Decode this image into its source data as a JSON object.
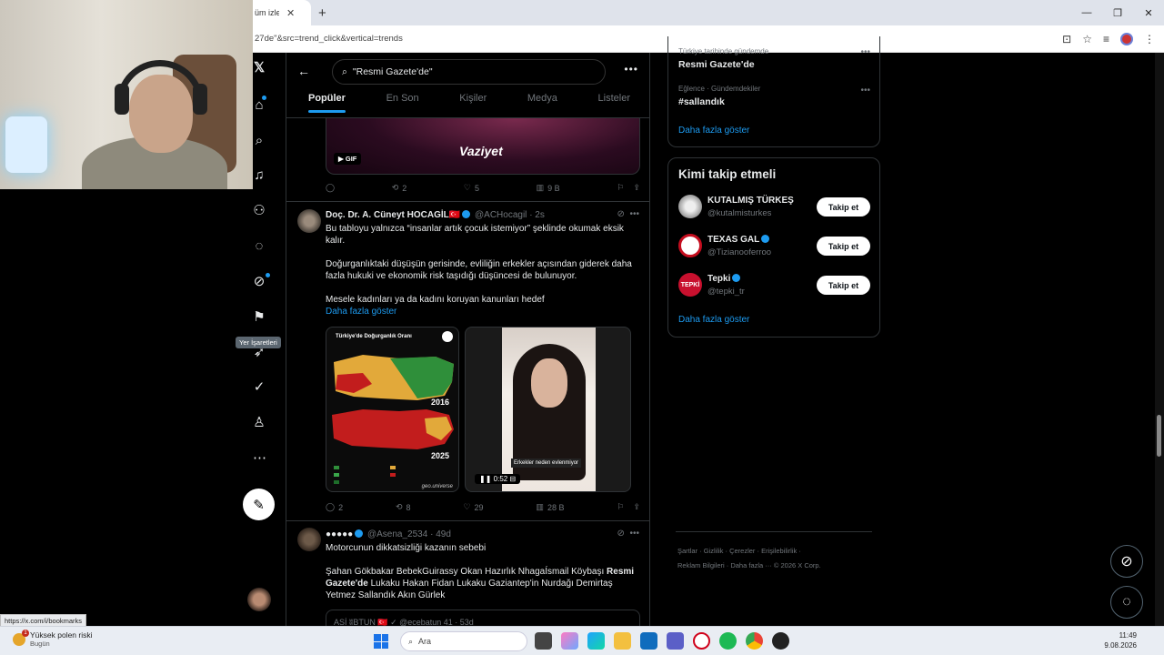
{
  "browser": {
    "tab_title": "üm izle | Ar",
    "tab_close": "✕",
    "new_tab": "+",
    "url": "27de\"&src=trend_click&vertical=trends",
    "window_minimize": "—",
    "window_restore": "❐",
    "window_close": "✕"
  },
  "search": {
    "query": "\"Resmi Gazete'de\""
  },
  "tabs": [
    {
      "label": "Popüler",
      "active": true
    },
    {
      "label": "En Son"
    },
    {
      "label": "Kişiler"
    },
    {
      "label": "Medya"
    },
    {
      "label": "Listeler"
    }
  ],
  "nav": {
    "tooltip": "Yer İşaretleri"
  },
  "gif_post": {
    "badge": "GIF",
    "logo": "Vaziyet",
    "replies": "",
    "reposts": "2",
    "likes": "5",
    "views": "9 B"
  },
  "post1": {
    "author": "Doç. Dr. A. Cüneyt HOCAGİL",
    "flag": "🇹🇷",
    "handle": "@ACHocagil",
    "time": "· 2s",
    "line1": "Bu tabloyu yalnızca “insanlar artık çocuk istemiyor” şeklinde okumak eksik kalır.",
    "line2": "Doğurganlıktaki düşüşün gerisinde, evliliğin erkekler açısından giderek daha fazla hukuki ve ekonomik risk taşıdığı düşüncesi de bulunuyor.",
    "line3": "Mesele kadınları ya da kadını koruyan kanunları hedef",
    "show_more": "Daha fazla göster",
    "map_title": "Türkiye'de Doğurganlık Oranı",
    "year1": "2016",
    "year2": "2025",
    "map_source": "geo.universe",
    "video_caption": "Erkekler neden evlenmiyor",
    "video_time": "0:52",
    "replies": "2",
    "reposts": "8",
    "likes": "29",
    "views": "28 B"
  },
  "post2": {
    "author": "●●●●●",
    "handle": "@Asena_2534",
    "time": "· 49d",
    "line1": "Motorcunun dikkatsizliği kazanın sebebi",
    "line2_pre": "Şahan Gökbakar BebekGuirassy Okan Hazırlık NhagaÍsmail Köybaşı ",
    "line2_bold": "Resmi Gazete'de",
    "line2_post": " Lukaku Hakan Fidan Lukaku Gaziantep'in Nurdağı Demirtaş Yetmez Sallandık Akın Gürlek",
    "quote": "ASİ ʬBTUN 🇹🇷 ✓ @ecebatun 41 · 53d"
  },
  "trends": [
    {
      "meta": "Türkiye tarihinde gündemde",
      "name": "Resmi Gazete'de"
    },
    {
      "meta": "Eğlence · Gündemdekiler",
      "name": "#sallandık"
    }
  ],
  "trends_more": "Daha fazla göster",
  "who_to_follow": {
    "title": "Kimi takip etmeli",
    "follow_label": "Takip et",
    "users": [
      {
        "name": "KUTALMIŞ TÜRKEŞ",
        "handle": "@kutalmisturkes",
        "verified": false
      },
      {
        "name": "TEXAS GAL",
        "handle": "@Tizianooferroo",
        "verified": true
      },
      {
        "name": "Tepki",
        "handle": "@tepki_tr",
        "verified": true
      }
    ],
    "show_more": "Daha fazla göster"
  },
  "footer": {
    "line1": "Şartlar  ·  Gizlilik  ·  Çerezler  ·  Erişilebilirlik  ·",
    "line2": "Reklam Bilgileri  ·  Daha fazla ···  © 2026 X Corp."
  },
  "status_url": "https://x.com/i/bookmarks",
  "taskbar": {
    "weather_title": "Yüksek polen riski",
    "weather_sub": "Bugün",
    "weather_badge": "1",
    "search_label": "Ara",
    "time": "11:49",
    "date": "9.08.2026"
  },
  "colors": {
    "accent": "#1d9bf0",
    "background": "#000000",
    "text": "#e7e9ea",
    "muted": "#71767b"
  }
}
